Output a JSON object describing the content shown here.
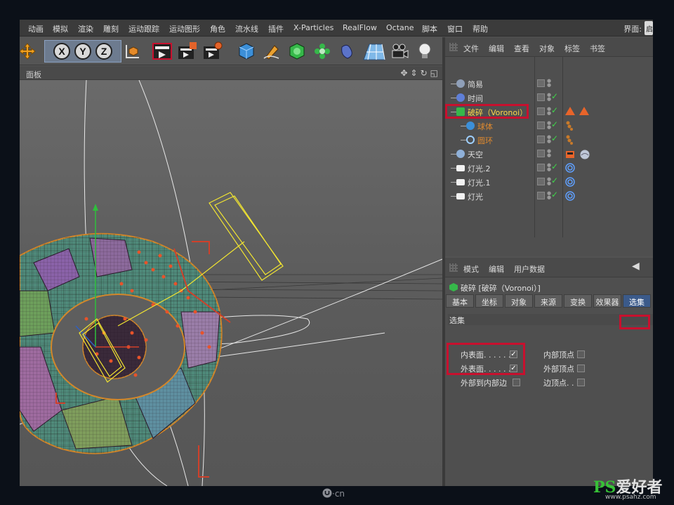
{
  "menubar": {
    "items": [
      "动画",
      "模拟",
      "渲染",
      "雕刻",
      "运动跟踪",
      "运动图形",
      "角色",
      "流水线",
      "插件",
      "X-Particles",
      "RealFlow",
      "Octane",
      "脚本",
      "窗口",
      "帮助"
    ],
    "layout_label": "界面:",
    "layout_value": "启"
  },
  "toolbar": {
    "axis_x": "X",
    "axis_y": "Y",
    "axis_z": "Z",
    "icons": [
      "move-icon",
      "axis-x-lock",
      "axis-y-lock",
      "axis-z-lock",
      "world-coordinate-icon",
      "render-view-icon",
      "render-picture-viewer-icon",
      "render-settings-icon",
      "cube-icon",
      "pen-icon",
      "subdivision-icon",
      "cloner-icon",
      "deformer-icon",
      "floor-icon",
      "camera-icon",
      "light-icon"
    ]
  },
  "viewport": {
    "title": "面板"
  },
  "object_manager": {
    "menu": [
      "文件",
      "编辑",
      "查看",
      "对象",
      "标签",
      "书签"
    ],
    "objects": [
      {
        "name": "简易",
        "indent": 0,
        "icon": "null-icon",
        "color": "#dcdcdc",
        "tags": []
      },
      {
        "name": "时间",
        "indent": 0,
        "icon": "time-icon",
        "color": "#dcdcdc",
        "tags": []
      },
      {
        "name": "破碎（Voronoi）",
        "indent": 0,
        "icon": "voronoi-fracture-icon",
        "color": "#ffd84a",
        "tags": [
          "effector-tag",
          "effector-tag"
        ]
      },
      {
        "name": "球体",
        "indent": 1,
        "icon": "sphere-icon",
        "color": "#e08a2e",
        "tags": [
          "phong-tag"
        ]
      },
      {
        "name": "圆环",
        "indent": 1,
        "icon": "torus-icon",
        "color": "#e08a2e",
        "tags": [
          "phong-tag"
        ]
      },
      {
        "name": "天空",
        "indent": 0,
        "icon": "sky-icon",
        "color": "#dcdcdc",
        "tags": [
          "material-tag",
          "sky-texture-tag"
        ]
      },
      {
        "name": "灯光.2",
        "indent": 0,
        "icon": "light-icon",
        "color": "#dcdcdc",
        "tags": [
          "target-tag"
        ]
      },
      {
        "name": "灯光.1",
        "indent": 0,
        "icon": "light-icon",
        "color": "#dcdcdc",
        "tags": [
          "target-tag"
        ]
      },
      {
        "name": "灯光",
        "indent": 0,
        "icon": "light-icon",
        "color": "#dcdcdc",
        "tags": [
          "target-tag"
        ]
      }
    ]
  },
  "attribute_manager": {
    "menu": [
      "模式",
      "编辑",
      "用户数据"
    ],
    "title": "破碎 [破碎（Voronoi）]",
    "tabs": [
      "基本",
      "坐标",
      "对象",
      "来源",
      "变换",
      "效果器",
      "选集"
    ],
    "active_tab": "选集",
    "section": "选集",
    "options_left": [
      {
        "label": "内表面. . . . . .",
        "checked": true
      },
      {
        "label": "外表面. . . . . .",
        "checked": true
      },
      {
        "label": "外部到内部边",
        "checked": false
      }
    ],
    "options_right": [
      {
        "label": "内部顶点",
        "checked": false
      },
      {
        "label": "外部顶点",
        "checked": false
      },
      {
        "label": "边顶点. .",
        "checked": false
      }
    ]
  },
  "watermark": {
    "ui_cn": "·cn",
    "ps_brand": "PS",
    "ps_text": "爱好者",
    "url": "www.psahz.com"
  },
  "colors": {
    "highlight": "#c8102e",
    "active_tab": "#3b5a8a",
    "check": "#3fd44a"
  }
}
